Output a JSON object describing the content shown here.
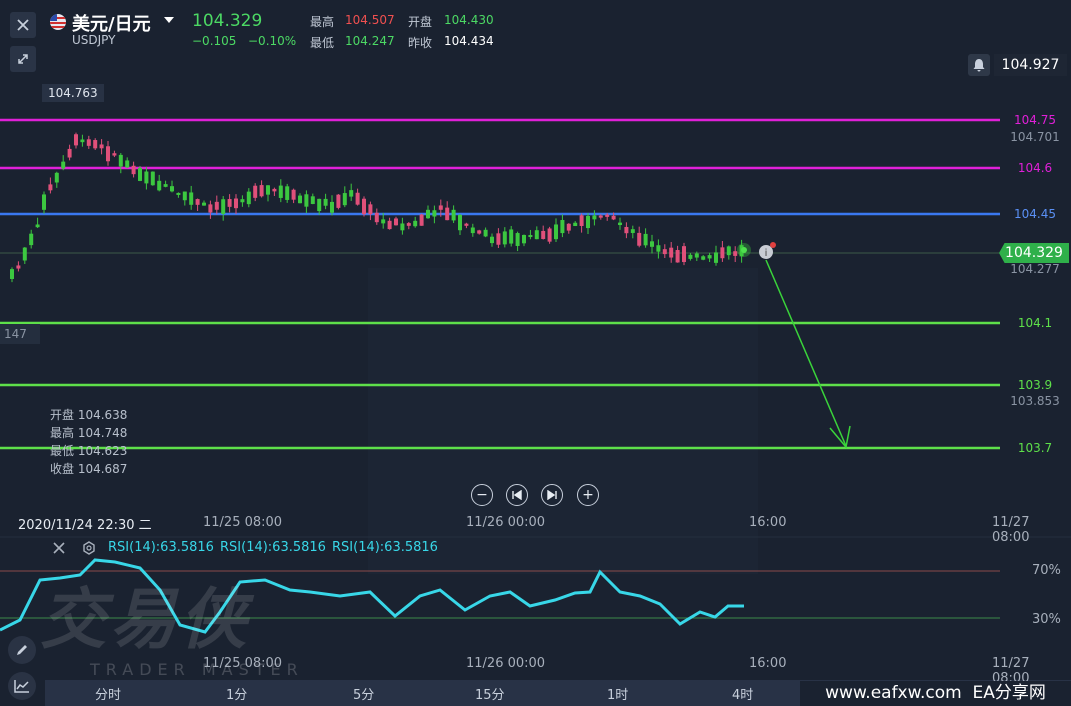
{
  "header": {
    "symbol_name": "美元/日元",
    "symbol_code": "USDJPY",
    "last_price": "104.329",
    "change": "−0.105",
    "change_pct": "−0.10%",
    "high_label": "最高",
    "high_value": "104.507",
    "open_label": "开盘",
    "open_value": "104.430",
    "low_label": "最低",
    "low_value": "104.247",
    "prev_close_label": "昨收",
    "prev_close_value": "104.434"
  },
  "price_axis": {
    "top_value": "104.927",
    "current_price": "104.329",
    "marks": [
      "104.701",
      "104.277",
      "103.853"
    ],
    "left_stub": "147"
  },
  "levels": [
    {
      "label": "104.75",
      "color": "#e020d8"
    },
    {
      "label": "104.6",
      "color": "#e020d8"
    },
    {
      "label": "104.45",
      "color": "#3a78f0"
    },
    {
      "label": "104.1",
      "color": "#5ee04a"
    },
    {
      "label": "103.9",
      "color": "#5ee04a"
    },
    {
      "label": "103.7",
      "color": "#5ee04a"
    }
  ],
  "peak_label": "104.763",
  "ohlc": {
    "open": "开盘 104.638",
    "high": "最高 104.748",
    "low": "最低 104.623",
    "close": "收盘 104.687"
  },
  "crosshair_time": "2020/11/24 22:30 二",
  "x_axis": [
    "11/25 08:00",
    "11/26 00:00",
    "16:00",
    "11/27 08:00"
  ],
  "rsi": {
    "labels": [
      "RSI(14):63.5816",
      "RSI(14):63.5816",
      "RSI(14):63.5816"
    ],
    "level_high": "70%",
    "level_low": "30%",
    "x_axis": [
      "11/25 08:00",
      "11/26 00:00",
      "16:00",
      "11/27 08:00"
    ],
    "line_color": "#38d7e8"
  },
  "watermark": {
    "main": "交易侠",
    "sub": "TRADER MASTER"
  },
  "timeframes": [
    "分时",
    "1分",
    "5分",
    "15分",
    "1时",
    "4时"
  ],
  "footer_brand": "www.eafxw.com  EA分享网",
  "icons": [
    "close-icon",
    "flag-icon",
    "dropdown-icon",
    "collapse-icon",
    "bell-icon",
    "zoom-out-icon",
    "rewind-icon",
    "forward-icon",
    "zoom-in-icon",
    "pencil-icon",
    "chart-line-icon",
    "settings-icon"
  ]
}
